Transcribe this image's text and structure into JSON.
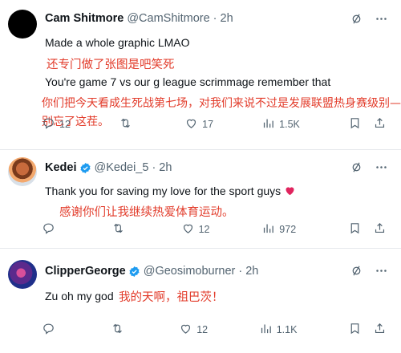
{
  "tweets": [
    {
      "name": "Cam Shitmore",
      "handle": "@CamShitmore",
      "time": "2h",
      "text1": "Made a whole graphic LMAO",
      "cn1": "还专门做了张图是吧笑死",
      "text2": "You're game 7 vs our g league scrimmage remember that",
      "cn2a": "你们把今天看成生死战第七场，对我们来说不过是发展联盟热身赛级别——",
      "cn2b": "别忘了这茬。",
      "reply_count": "12",
      "retweet_count": "",
      "like_count": "17",
      "views": "1.5K"
    },
    {
      "name": "Kedei",
      "handle": "@Kedei_5",
      "time": "2h",
      "text1": "Thank you for saving my love for the sport guys",
      "cn1": "感谢你们让我继续热爱体育运动。",
      "reply_count": "",
      "retweet_count": "",
      "like_count": "12",
      "views": "972"
    },
    {
      "name": "ClipperGeorge",
      "handle": "@Geosimoburner",
      "time": "2h",
      "text1": "Zu oh my god",
      "cn1": "我的天啊，祖巴茨！",
      "reply_count": "",
      "retweet_count": "",
      "like_count": "12",
      "views": "1.1K"
    }
  ],
  "colors": {
    "accent": "#1d9bf0",
    "annotation": "#e23b2a",
    "muted": "#536471"
  },
  "icons": [
    "grok-icon",
    "more-icon",
    "reply-icon",
    "retweet-icon",
    "like-icon",
    "views-icon",
    "bookmark-icon",
    "share-icon"
  ]
}
